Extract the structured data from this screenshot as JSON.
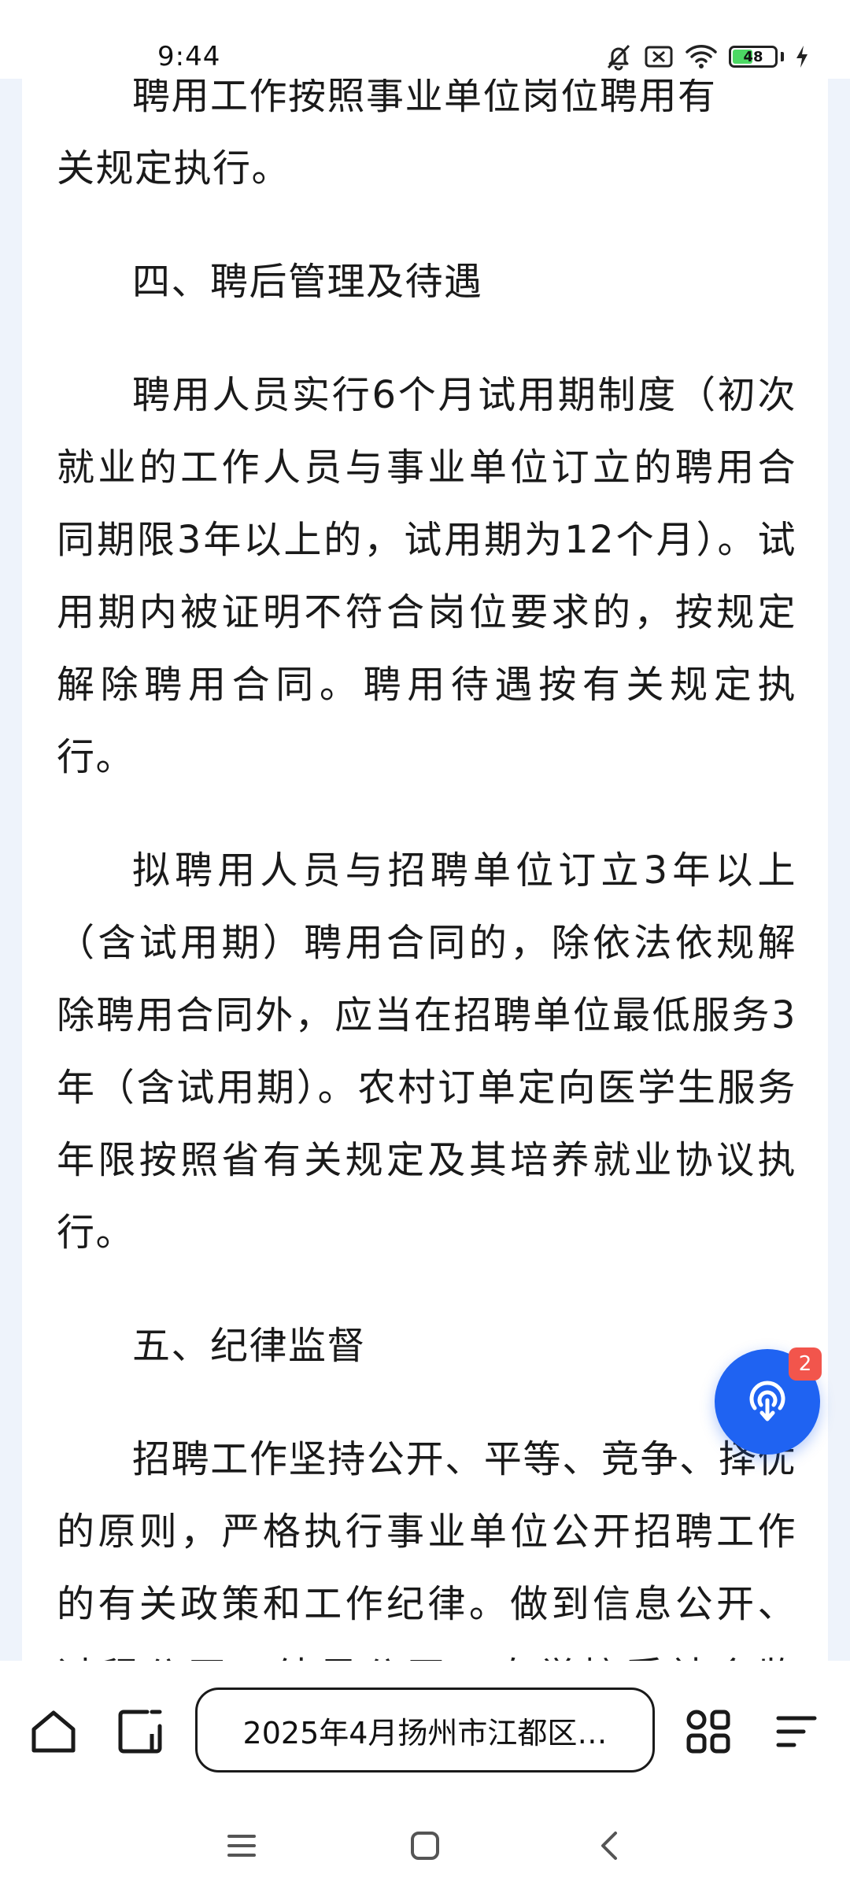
{
  "status_bar": {
    "time": "9:44",
    "battery_level": "48",
    "battery_fraction": 0.48,
    "icons": [
      "mute-bell-icon",
      "no-sim-icon",
      "wifi-icon",
      "battery-icon",
      "charging-bolt-icon"
    ]
  },
  "article": {
    "top_partial_line": "聘用工作按照事业单位岗位聘用有",
    "top_partial_tail": "关规定执行。",
    "heading_4": "四、聘后管理及待遇",
    "para_probation": "聘用人员实行6个月试用期制度（初次就业的工作人员与事业单位订立的聘用合同期限3年以上的，试用期为12个月）。试用期内被证明不符合岗位要求的，按规定解除聘用合同。聘用待遇按有关规定执行。",
    "para_service": "拟聘用人员与招聘单位订立3年以上（含试用期）聘用合同的，除依法依规解除聘用合同外，应当在招聘单位最低服务3年（含试用期）。农村订单定向医学生服务年限按照省有关规定及其培养就业协议执行。",
    "heading_5": "五、纪律监督",
    "para_discipline": "招聘工作坚持公开、平等、竞争、择优的原则，严格执行事业单位公开招聘工作的有关政策和工作纪律。做到信息公开、过程公开、结果公开，自觉接受社会监督。"
  },
  "fab": {
    "icon": "listen-broadcast-icon",
    "badge": "2",
    "color": "#1f63f2",
    "badge_color": "#f2554c"
  },
  "toolbar": {
    "home_icon": "home-icon",
    "tabs_icon": "tabs-switch-icon",
    "url_text": "2025年4月扬州市江都区…",
    "apps_icon": "apps-grid-icon",
    "menu_icon": "menu-lines-icon"
  },
  "navbar": {
    "menu_icon": "recent-apps-icon",
    "home_icon": "home-square-icon",
    "back_icon": "back-chevron-icon"
  }
}
